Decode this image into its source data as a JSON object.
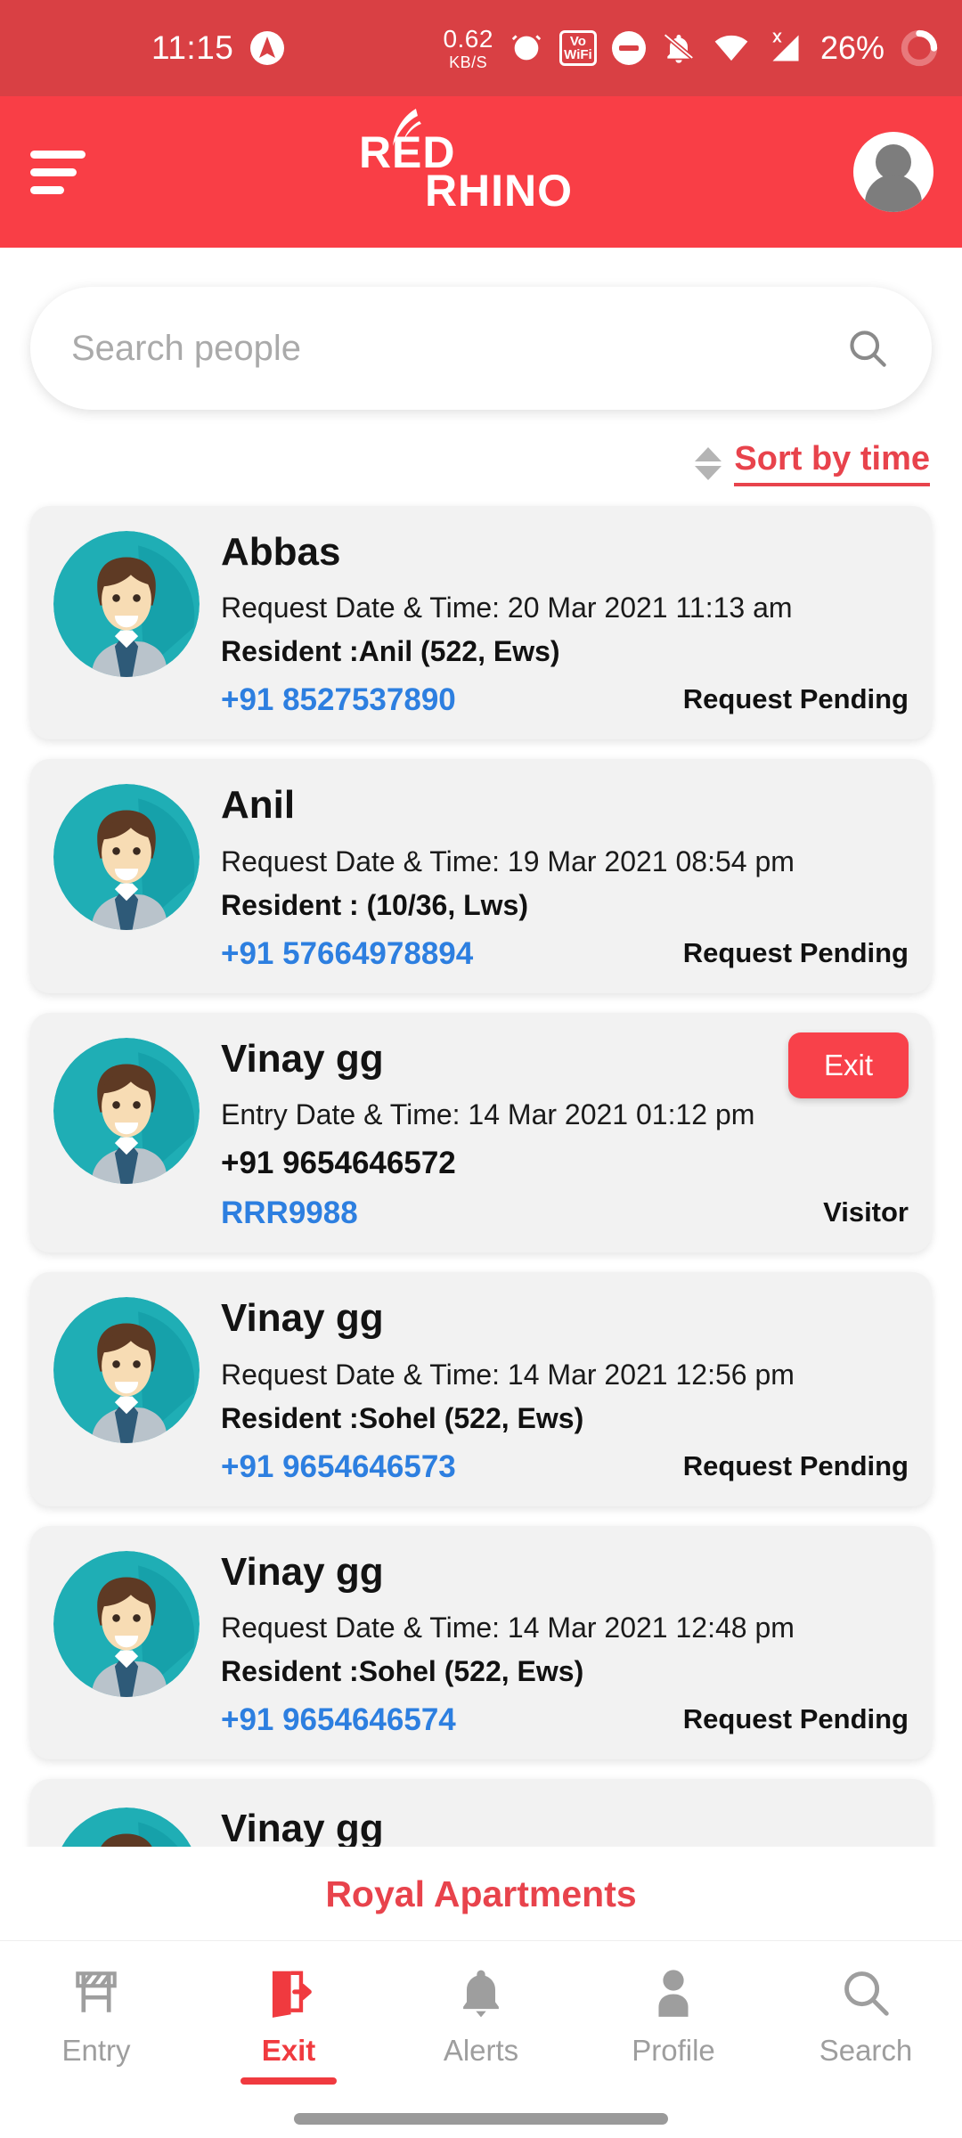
{
  "status_bar": {
    "time": "11:15",
    "app_icon": "adaway-icon",
    "data_rate_value": "0.62",
    "data_rate_unit": "KB/S",
    "icons": [
      "alarm-icon",
      "vowifi-icon",
      "do-not-disturb-icon",
      "notifications-muted-icon",
      "wifi-icon",
      "mobile-signal-off-icon"
    ],
    "vowifi_top": "Vo",
    "vowifi_bottom": "WiFi",
    "battery_percent": "26%",
    "colors": {
      "background": "#D94044",
      "foreground": "#ffffff"
    }
  },
  "header": {
    "menu_icon": "hamburger-menu-icon",
    "logo_line1": "RED",
    "logo_line2": "RHINO",
    "avatar_icon": "user-avatar-icon",
    "colors": {
      "background": "#F93E46",
      "foreground": "#ffffff"
    }
  },
  "search": {
    "placeholder": "Search people",
    "value": "",
    "icon": "search-icon"
  },
  "sort": {
    "label": "Sort by time",
    "icon": "sort-arrows-icon",
    "color": "#E8434C"
  },
  "list": [
    {
      "name": "Abbas",
      "date_label": "Request Date & Time: 20 Mar 2021 11:13 am",
      "resident": "Resident :Anil (522, Ews)",
      "phone": "+91 8527537890",
      "phone_style": "blue",
      "vehicle": "",
      "status": "Request Pending",
      "action": ""
    },
    {
      "name": "Anil",
      "date_label": "Request Date & Time: 19 Mar 2021 08:54 pm",
      "resident": "Resident : (10/36, Lws)",
      "phone": "+91 57664978894",
      "phone_style": "blue",
      "vehicle": "",
      "status": "Request Pending",
      "action": ""
    },
    {
      "name": "Vinay gg",
      "date_label": "Entry Date & Time: 14 Mar 2021 01:12 pm",
      "resident": "",
      "phone": "+91 9654646572",
      "phone_style": "dark",
      "vehicle": "RRR9988",
      "status": "Visitor",
      "action": "Exit"
    },
    {
      "name": "Vinay gg",
      "date_label": "Request Date & Time: 14 Mar 2021 12:56 pm",
      "resident": "Resident :Sohel (522, Ews)",
      "phone": "+91 9654646573",
      "phone_style": "blue",
      "vehicle": "",
      "status": "Request Pending",
      "action": ""
    },
    {
      "name": "Vinay gg",
      "date_label": "Request Date & Time: 14 Mar 2021 12:48 pm",
      "resident": "Resident :Sohel (522, Ews)",
      "phone": "+91 9654646574",
      "phone_style": "blue",
      "vehicle": "",
      "status": "Request Pending",
      "action": ""
    }
  ],
  "partial_card": {
    "name": "Vinay gg"
  },
  "footer": {
    "complex_name": "Royal Apartments",
    "complex_color": "#E8434C",
    "nav": [
      {
        "label": "Entry",
        "icon": "barrier-icon",
        "active": false
      },
      {
        "label": "Exit",
        "icon": "exit-door-icon",
        "active": true
      },
      {
        "label": "Alerts",
        "icon": "bell-icon",
        "active": false
      },
      {
        "label": "Profile",
        "icon": "person-icon",
        "active": false
      },
      {
        "label": "Search",
        "icon": "search-icon",
        "active": false
      }
    ],
    "active_color": "#F03A3F",
    "inactive_color": "#9e9e9e"
  }
}
